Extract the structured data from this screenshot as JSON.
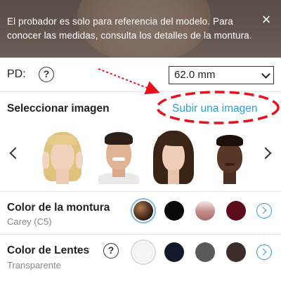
{
  "banner": {
    "message": "El probador es solo para referencia del modelo. Para conocer las medidas, consulta los detalles de la montura.",
    "close_icon": "close-icon"
  },
  "pd": {
    "label": "PD:",
    "help_icon": "question-icon",
    "help_symbol": "?",
    "value": "62.0 mm"
  },
  "image_select": {
    "title": "Seleccionar imagen",
    "upload_label": "Subir una imagen",
    "annotation_color": "#e8101a",
    "models": [
      {
        "name": "model-blonde-woman"
      },
      {
        "name": "model-dark-hair-man"
      },
      {
        "name": "model-brunette-woman"
      },
      {
        "name": "model-dark-skin-woman"
      }
    ]
  },
  "frame_color": {
    "title": "Color de la montura",
    "selected": "Carey (C5)",
    "swatches": [
      "#5a3a28",
      "#0a0a0a",
      "#c58c8c",
      "#5b0d1e"
    ]
  },
  "lens_color": {
    "title": "Color de Lentes",
    "help_symbol": "?",
    "selected": "Transparente",
    "swatches": [
      "#f5f5f5",
      "#111a2a",
      "#5a5a5a",
      "#3a2e2a"
    ]
  },
  "colors": {
    "accent": "#2a9fd8"
  }
}
